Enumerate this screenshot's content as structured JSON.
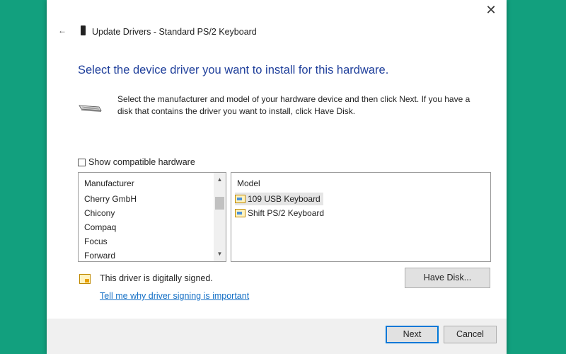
{
  "window": {
    "title": "Update Drivers - Standard PS/2 Keyboard",
    "back_glyph": "←",
    "close_glyph": "✕"
  },
  "heading": "Select the device driver you want to install for this hardware.",
  "description": "Select the manufacturer and model of your hardware device and then click Next. If you have a disk that contains the driver you want to install, click Have Disk.",
  "compatible_checkbox": {
    "label": "Show compatible hardware",
    "checked": false
  },
  "manufacturer_list": {
    "header": "Manufacturer",
    "items": [
      "Cherry GmbH",
      "Chicony",
      "Compaq",
      "Focus",
      "Forward"
    ],
    "scroll_up": "▲",
    "scroll_down": "▼"
  },
  "model_list": {
    "header": "Model",
    "items": [
      {
        "label": "109 USB Keyboard",
        "selected": true
      },
      {
        "label": "Shift PS/2 Keyboard",
        "selected": false
      }
    ]
  },
  "signing": {
    "status": "This driver is digitally signed.",
    "link": "Tell me why driver signing is important"
  },
  "buttons": {
    "have_disk": "Have Disk...",
    "next": "Next",
    "cancel": "Cancel"
  },
  "colors": {
    "background": "#12a07e",
    "heading": "#1f3f9b",
    "link": "#1570c6",
    "focus_border": "#0078d7"
  }
}
